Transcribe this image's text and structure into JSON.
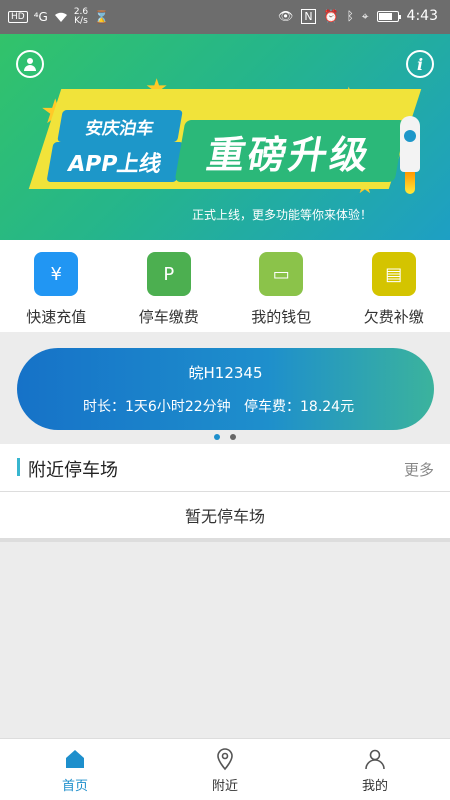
{
  "status_bar": {
    "network": "HD",
    "signal": "⁴G",
    "speed_value": "2.6",
    "speed_unit": "K/s",
    "time": "4:43",
    "battery_level": 0.75,
    "icons": [
      "eye-icon",
      "nfc-icon",
      "alarm-icon",
      "bluetooth-icon",
      "location-icon",
      "battery-icon"
    ]
  },
  "banner": {
    "tag_line1": "安庆泊车",
    "tag_line2": "APP上线",
    "headline": "重磅升级",
    "subtitle": "正式上线，更多功能等你来体验！",
    "colors": {
      "start": "#32c36a",
      "end": "#1e9fc4",
      "band": "#f1e33a"
    }
  },
  "actions": [
    {
      "label": "快速充值",
      "icon": "recharge-icon",
      "color": "#2196f3"
    },
    {
      "label": "停车缴费",
      "icon": "parking-fee-icon",
      "color": "#4caf50"
    },
    {
      "label": "我的钱包",
      "icon": "wallet-icon",
      "color": "#8bc34a"
    },
    {
      "label": "欠费补缴",
      "icon": "arrears-icon",
      "color": "#d4c400"
    }
  ],
  "parking_card": {
    "plate": "皖H12345",
    "duration_label": "时长：",
    "duration": "1天6小时22分钟",
    "fee_label": "停车费：",
    "fee": "18.24元"
  },
  "carousel": {
    "count": 2,
    "active": 0
  },
  "nearby": {
    "title": "附近停车场",
    "more": "更多",
    "empty": "暂无停车场"
  },
  "bottom_nav": [
    {
      "label": "首页",
      "icon": "home-icon",
      "active": true
    },
    {
      "label": "附近",
      "icon": "location-pin-icon",
      "active": false
    },
    {
      "label": "我的",
      "icon": "profile-icon",
      "active": false
    }
  ],
  "accent": "#1e8fcc"
}
